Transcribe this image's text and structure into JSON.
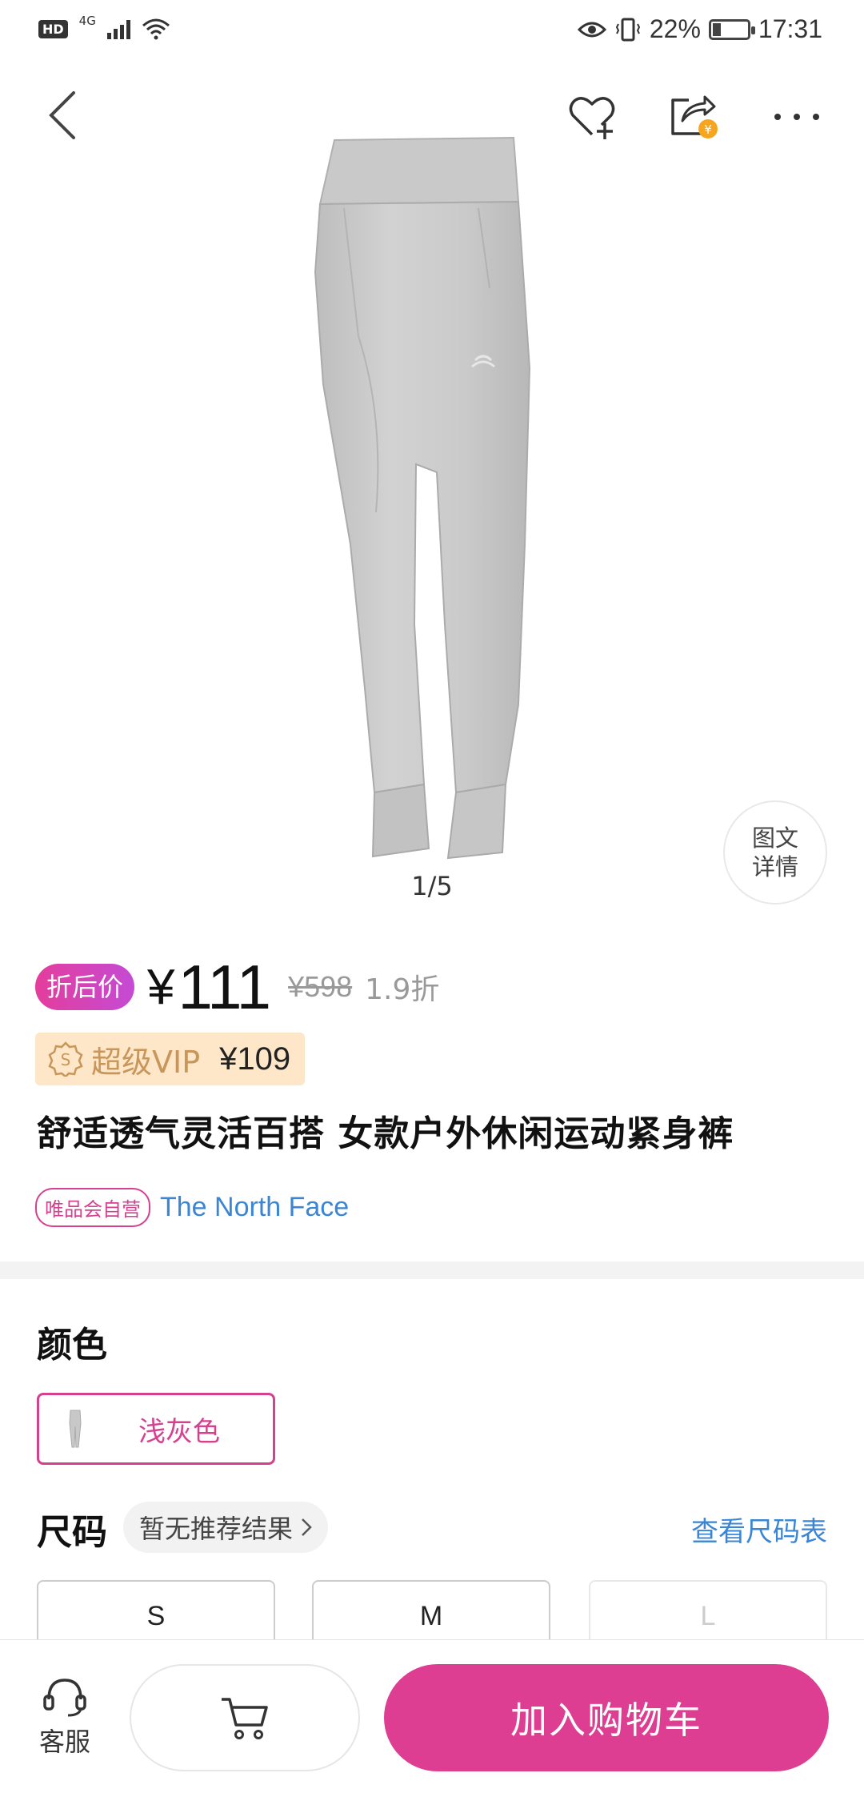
{
  "status_bar": {
    "hd": "HD",
    "network": "4G",
    "battery_pct": "22%",
    "time": "17:31"
  },
  "nav": {
    "back_icon": "chevron-left-icon",
    "favorite_icon": "heart-plus-icon",
    "share_icon": "share-earn-icon",
    "share_badge": "¥",
    "more_icon": "more-dots-icon"
  },
  "gallery": {
    "counter": "1/5",
    "detail_line1": "图文",
    "detail_line2": "详情"
  },
  "price": {
    "badge": "折后价",
    "currency": "¥",
    "amount": "111",
    "original": "¥598",
    "discount": "1.9折"
  },
  "vip": {
    "label": "超级VIP",
    "price": "¥109"
  },
  "product": {
    "title": "舒适透气灵活百搭 女款户外休闲运动紧身裤",
    "self_operated_badge": "唯品会自营",
    "brand": "The North Face"
  },
  "color": {
    "section_label": "颜色",
    "selected": "浅灰色"
  },
  "size": {
    "section_label": "尺码",
    "recommend_hint": "暂无推荐结果",
    "size_chart_link": "查看尺码表",
    "options": [
      {
        "label": "S",
        "available": true
      },
      {
        "label": "M",
        "available": true
      },
      {
        "label": "L",
        "available": false
      }
    ]
  },
  "bottom_bar": {
    "service_label": "客服",
    "add_to_cart": "加入购物车"
  },
  "colors": {
    "accent": "#de3e92",
    "brand_link": "#3a86d4",
    "vip_bg": "#fde7c8",
    "vip_text": "#c8965a"
  }
}
